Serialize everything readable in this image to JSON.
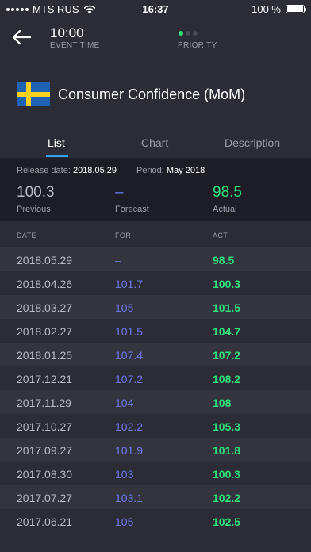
{
  "status": {
    "carrier": "MTS RUS",
    "time": "16:37",
    "battery": "100 %"
  },
  "header": {
    "event_time": "10:00",
    "event_time_label": "EVENT TIME",
    "priority_label": "PRIORITY",
    "priority_level": 1,
    "priority_max": 3
  },
  "event": {
    "title": "Consumer Confidence (MoM)",
    "flag": "sweden-flag"
  },
  "tabs": [
    {
      "label": "List",
      "active": true
    },
    {
      "label": "Chart",
      "active": false
    },
    {
      "label": "Description",
      "active": false
    }
  ],
  "info": {
    "release_label": "Release date:",
    "release_date": "2018.05.29",
    "period_label": "Period:",
    "period": "May 2018",
    "previous": {
      "value": "100.3",
      "label": "Previous"
    },
    "forecast": {
      "value": "–",
      "label": "Forecast"
    },
    "actual": {
      "value": "98.5",
      "label": "Actual"
    }
  },
  "table": {
    "headers": [
      "DATE",
      "FOR.",
      "ACT."
    ],
    "rows": [
      {
        "date": "2018.05.29",
        "forecast": "–",
        "actual": "98.5"
      },
      {
        "date": "2018.04.26",
        "forecast": "101.7",
        "actual": "100.3"
      },
      {
        "date": "2018.03.27",
        "forecast": "105",
        "actual": "101.5"
      },
      {
        "date": "2018.02.27",
        "forecast": "101.5",
        "actual": "104.7"
      },
      {
        "date": "2018.01.25",
        "forecast": "107.4",
        "actual": "107.2"
      },
      {
        "date": "2017.12.21",
        "forecast": "107.2",
        "actual": "108.2"
      },
      {
        "date": "2017.11.29",
        "forecast": "104",
        "actual": "108"
      },
      {
        "date": "2017.10.27",
        "forecast": "102.2",
        "actual": "105.3"
      },
      {
        "date": "2017.09.27",
        "forecast": "101.9",
        "actual": "101.8"
      },
      {
        "date": "2017.08.30",
        "forecast": "103",
        "actual": "100.3"
      },
      {
        "date": "2017.07.27",
        "forecast": "103.1",
        "actual": "102.2"
      },
      {
        "date": "2017.06.21",
        "forecast": "105",
        "actual": "102.5"
      }
    ]
  },
  "colors": {
    "background": "#2b2c35",
    "panel": "#1d1e25",
    "accent_green": "#2fe07b",
    "forecast_blue": "#6d78ee",
    "tab_underline": "#2fa3e8"
  }
}
